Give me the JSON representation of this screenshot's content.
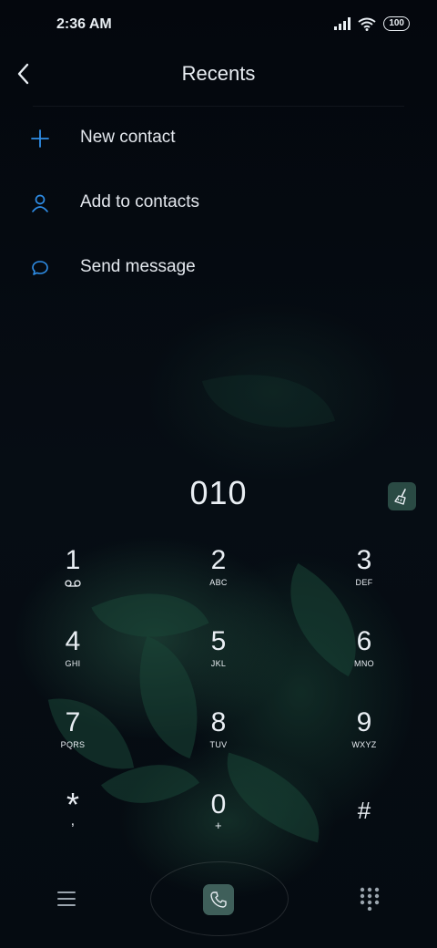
{
  "status": {
    "time": "2:36 AM",
    "battery": "100"
  },
  "header": {
    "title": "Recents"
  },
  "menu": [
    {
      "icon": "plus-icon",
      "label": "New contact"
    },
    {
      "icon": "person-icon",
      "label": "Add to contacts"
    },
    {
      "icon": "chat-bubble-icon",
      "label": "Send message"
    }
  ],
  "dialer": {
    "number": "010",
    "keys": [
      {
        "num": "1",
        "sub": "voicemail"
      },
      {
        "num": "2",
        "sub": "ABC"
      },
      {
        "num": "3",
        "sub": "DEF"
      },
      {
        "num": "4",
        "sub": "GHI"
      },
      {
        "num": "5",
        "sub": "JKL"
      },
      {
        "num": "6",
        "sub": "MNO"
      },
      {
        "num": "7",
        "sub": "PQRS"
      },
      {
        "num": "8",
        "sub": "TUV"
      },
      {
        "num": "9",
        "sub": "WXYZ"
      },
      {
        "num": "*",
        "sub": ","
      },
      {
        "num": "0",
        "sub": "+"
      },
      {
        "num": "#",
        "sub": ""
      }
    ]
  },
  "colors": {
    "accent": "#2f8ee8",
    "background": "#050a12",
    "call_button": "#3f5f5a"
  }
}
